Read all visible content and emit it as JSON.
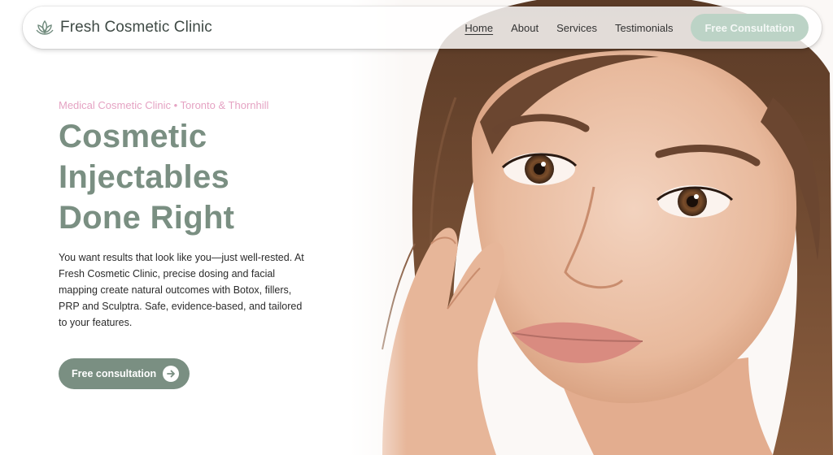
{
  "brand": {
    "name": "Fresh Cosmetic Clinic",
    "logo_icon": "lotus-icon"
  },
  "nav": {
    "links": [
      {
        "label": "Home",
        "active": true
      },
      {
        "label": "About",
        "active": false
      },
      {
        "label": "Services",
        "active": false
      },
      {
        "label": "Testimonials",
        "active": false
      }
    ],
    "cta_label": "Free Consultation"
  },
  "hero": {
    "eyebrow": "Medical Cosmetic Clinic • Toronto & Thornhill",
    "headline": [
      "Cosmetic",
      "Injectables",
      "Done Right"
    ],
    "body": "You want results that look like you—just well-rested. At Fresh Cosmetic Clinic, precise dosing and facial mapping create natural outcomes with Botox, fillers, PRP and Sculptra. Safe, evidence-based, and tailored to your features.",
    "cta_label": "Free consultation",
    "cta_icon": "arrow-right-icon"
  },
  "colors": {
    "accent_green": "#7a8f82",
    "nav_cta_green": "#bcd3c6",
    "eyebrow_pink": "#e5a3c3",
    "text_dark": "#2b2b2b"
  }
}
